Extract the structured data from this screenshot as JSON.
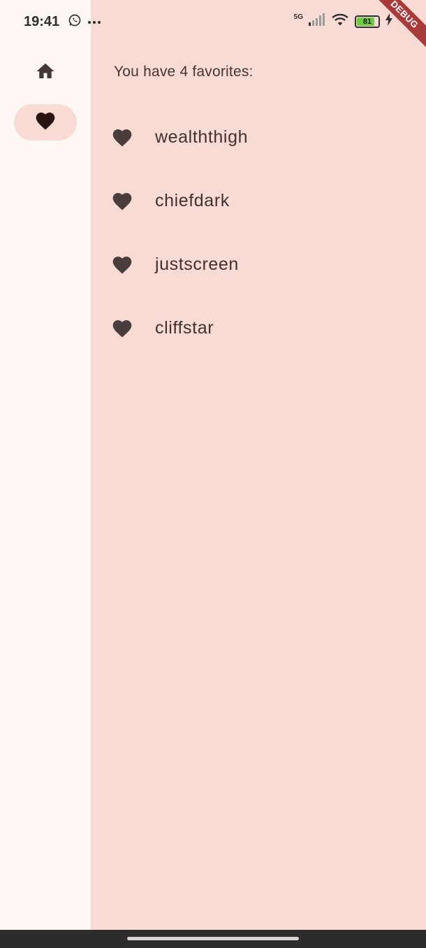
{
  "status_bar": {
    "time": "19:41",
    "network": "5G",
    "battery": "81",
    "icons": [
      "whatsapp-icon",
      "more-icon",
      "signal-icon",
      "wifi-icon",
      "battery-icon",
      "charging-icon"
    ]
  },
  "debug_banner": "DEBUG",
  "rail": {
    "destinations": [
      {
        "icon": "home-icon",
        "selected": false
      },
      {
        "icon": "favorite-icon",
        "selected": true
      }
    ]
  },
  "favorites": {
    "header": "You have 4 favorites:",
    "items": [
      {
        "label": "wealththigh",
        "icon": "heart-icon"
      },
      {
        "label": "chiefdark",
        "icon": "heart-icon"
      },
      {
        "label": "justscreen",
        "icon": "heart-icon"
      },
      {
        "label": "cliffstar",
        "icon": "heart-icon"
      }
    ]
  },
  "colors": {
    "content_bg": "#f8dbd4",
    "rail_bg": "#fff7f4",
    "icon": "#443635",
    "selected_indicator": "#f8dbd4",
    "debug": "#a83a3a"
  }
}
